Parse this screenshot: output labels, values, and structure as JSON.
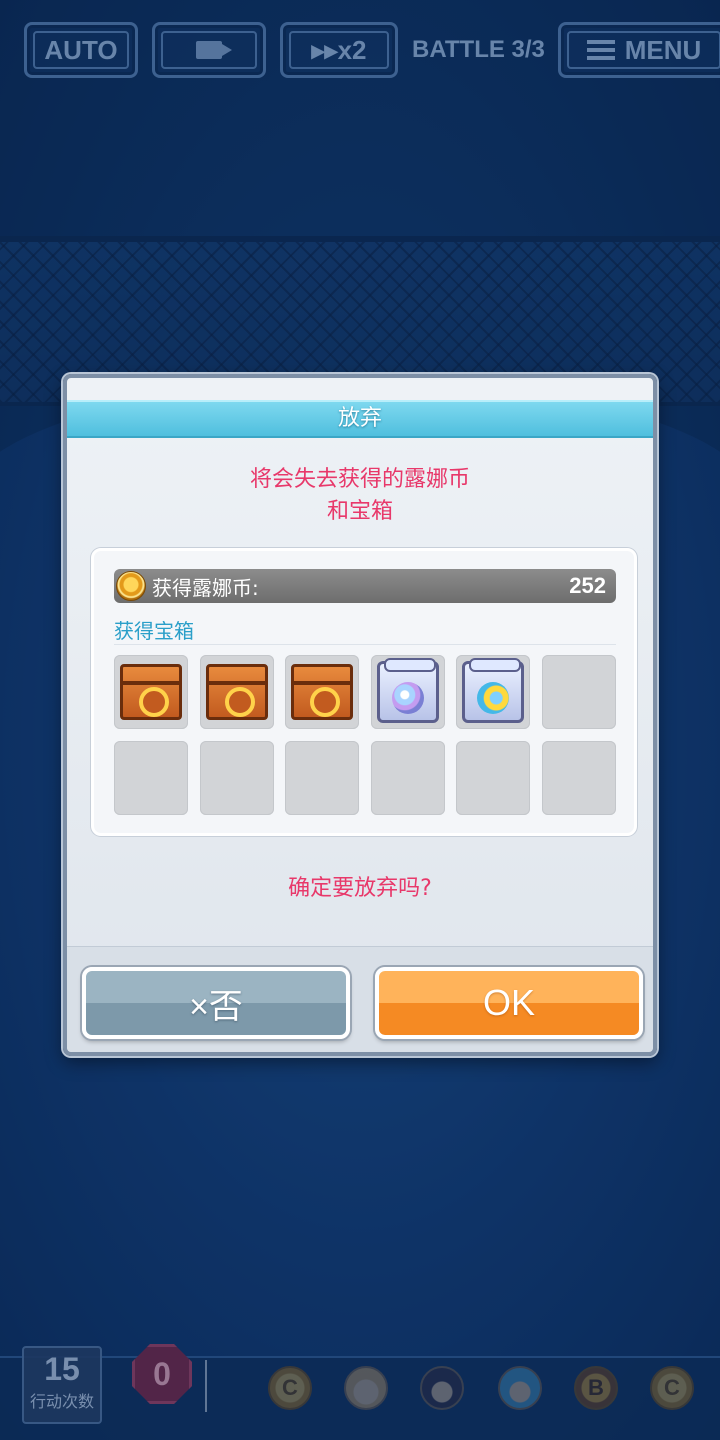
{
  "hud": {
    "auto_label": "AUTO",
    "speed_label": "▸▸x2",
    "battle_label": "BATTLE 3/3",
    "menu_label": "MENU"
  },
  "dialog": {
    "title": "放弃",
    "warning_line1": "将会失去获得的露娜币",
    "warning_line2": "和宝箱",
    "coins_label": "获得露娜币:",
    "coins_value": "252",
    "chests_label": "获得宝箱",
    "chest_slots": [
      "bronze-chest",
      "bronze-chest",
      "bronze-chest",
      "silver-chest",
      "silver-gold-chest",
      "empty",
      "empty",
      "empty",
      "empty",
      "empty",
      "empty",
      "empty"
    ],
    "confirm_question": "确定要放弃吗?",
    "no_button": "×否",
    "ok_button": "OK"
  },
  "bottom": {
    "move_count": "15",
    "move_count_label": "行动次数",
    "counter": "0",
    "turn_order": [
      {
        "type": "coin",
        "letter": "C"
      },
      {
        "type": "blonde-character"
      },
      {
        "type": "dark-haired-character"
      },
      {
        "type": "blue-haired-character"
      },
      {
        "type": "boss",
        "letter": "B"
      },
      {
        "type": "coin",
        "letter": "C"
      }
    ]
  },
  "colors": {
    "warning_text": "#e8386a",
    "title_bar": "#4fbfde",
    "ok_button": "#f58a23",
    "no_button": "#7d99aa",
    "chest_label": "#2a9fc9"
  }
}
